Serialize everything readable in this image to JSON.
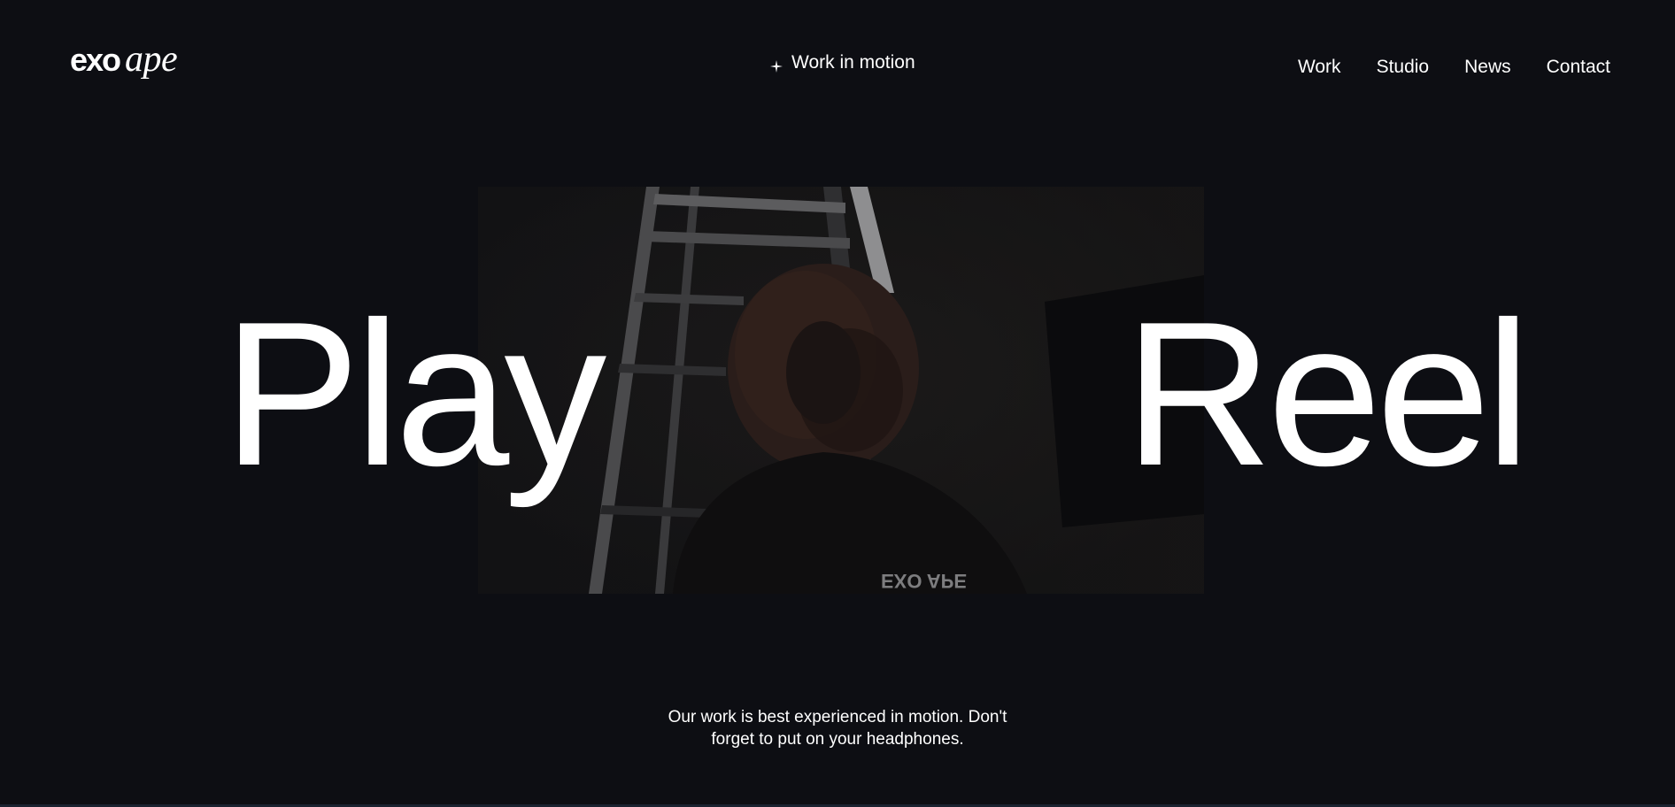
{
  "header": {
    "logo": {
      "primary": "exo",
      "secondary": "ape"
    },
    "tagline": {
      "icon": "sparkle-icon",
      "label": "Work in motion"
    },
    "nav": [
      {
        "label": "Work"
      },
      {
        "label": "Studio"
      },
      {
        "label": "News"
      },
      {
        "label": "Contact"
      }
    ]
  },
  "hero": {
    "left_word": "Play",
    "right_word": "Reel",
    "video_thumbnail": {
      "shirt_text": "EXO APE"
    }
  },
  "caption": {
    "line1": "Our work is best experienced in motion. Don't",
    "line2": "forget to put on your headphones."
  },
  "colors": {
    "background": "#0d0e13",
    "text": "#ffffff"
  }
}
